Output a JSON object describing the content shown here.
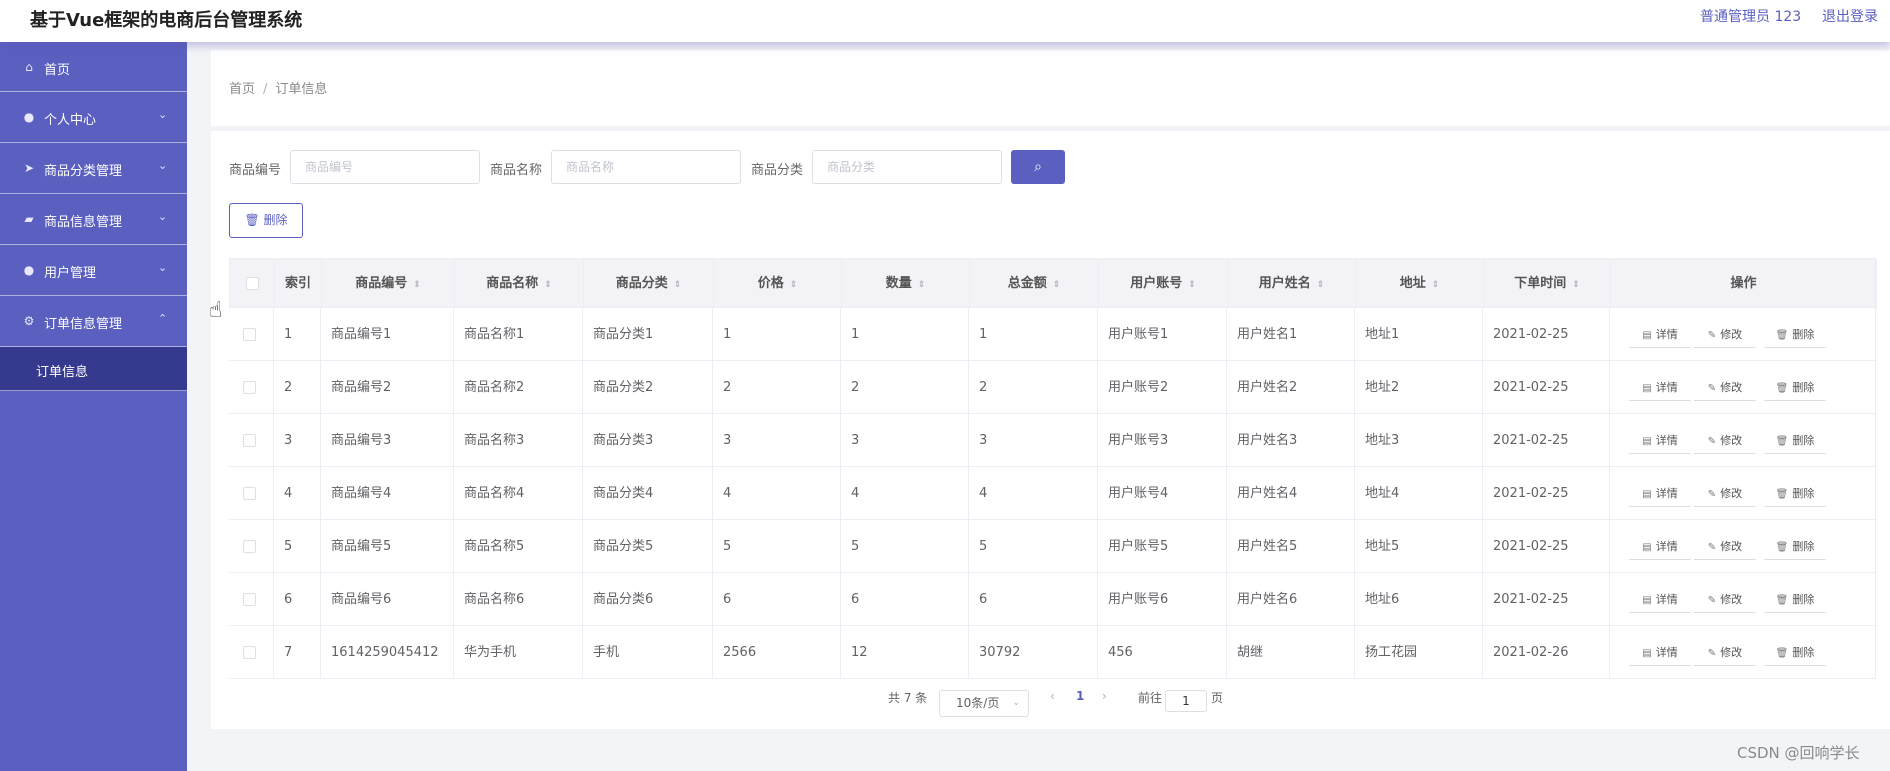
{
  "header": {
    "title": "基于Vue框架的电商后台管理系统",
    "user": "普通管理员 123",
    "logout": "退出登录"
  },
  "sidebar": {
    "items": [
      {
        "label": "首页",
        "icon": "home-icon"
      },
      {
        "label": "个人中心",
        "icon": "person-icon"
      },
      {
        "label": "商品分类管理",
        "icon": "send-icon"
      },
      {
        "label": "商品信息管理",
        "icon": "thumb-icon"
      },
      {
        "label": "用户管理",
        "icon": "user-icon"
      },
      {
        "label": "订单信息管理",
        "icon": "gear-icon"
      }
    ],
    "submenu": "订单信息"
  },
  "breadcrumb": {
    "home": "首页",
    "current": "订单信息"
  },
  "search": {
    "fields": [
      {
        "label": "商品编号",
        "placeholder": "商品编号"
      },
      {
        "label": "商品名称",
        "placeholder": "商品名称"
      },
      {
        "label": "商品分类",
        "placeholder": "商品分类"
      }
    ]
  },
  "toolbar": {
    "delete_label": "删除"
  },
  "table": {
    "headers": [
      "索引",
      "商品编号",
      "商品名称",
      "商品分类",
      "价格",
      "数量",
      "总金额",
      "用户账号",
      "用户姓名",
      "地址",
      "下单时间",
      "操作"
    ],
    "rows": [
      [
        "1",
        "商品编号1",
        "商品名称1",
        "商品分类1",
        "1",
        "1",
        "1",
        "用户账号1",
        "用户姓名1",
        "地址1",
        "2021-02-25"
      ],
      [
        "2",
        "商品编号2",
        "商品名称2",
        "商品分类2",
        "2",
        "2",
        "2",
        "用户账号2",
        "用户姓名2",
        "地址2",
        "2021-02-25"
      ],
      [
        "3",
        "商品编号3",
        "商品名称3",
        "商品分类3",
        "3",
        "3",
        "3",
        "用户账号3",
        "用户姓名3",
        "地址3",
        "2021-02-25"
      ],
      [
        "4",
        "商品编号4",
        "商品名称4",
        "商品分类4",
        "4",
        "4",
        "4",
        "用户账号4",
        "用户姓名4",
        "地址4",
        "2021-02-25"
      ],
      [
        "5",
        "商品编号5",
        "商品名称5",
        "商品分类5",
        "5",
        "5",
        "5",
        "用户账号5",
        "用户姓名5",
        "地址5",
        "2021-02-25"
      ],
      [
        "6",
        "商品编号6",
        "商品名称6",
        "商品分类6",
        "6",
        "6",
        "6",
        "用户账号6",
        "用户姓名6",
        "地址6",
        "2021-02-25"
      ],
      [
        "7",
        "1614259045412",
        "华为手机",
        "手机",
        "2566",
        "12",
        "30792",
        "456",
        "胡继",
        "扬工花园",
        "2021-02-26"
      ]
    ],
    "actions": [
      "详情",
      "修改",
      "删除"
    ]
  },
  "pagination": {
    "total": "共 7 条",
    "page_size": "10条/页",
    "current_page": "1",
    "goto_label": "前往",
    "goto_value": "1",
    "page_suffix": "页"
  },
  "watermark": "CSDN @回响学长",
  "colors": {
    "accent": "#5a5fc0",
    "sidebar_active": "#353a8f"
  }
}
